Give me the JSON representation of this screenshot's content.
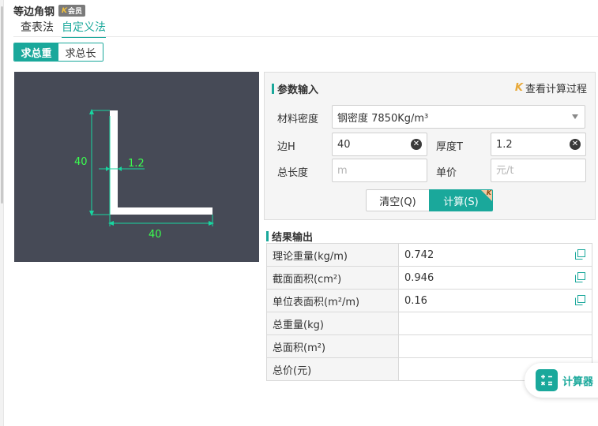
{
  "app": {
    "title": "等边角钢",
    "badge_text": "会员",
    "badge_mark": "K"
  },
  "tabs": [
    {
      "label": "查表法",
      "active": false
    },
    {
      "label": "自定义法",
      "active": true
    }
  ],
  "mode": {
    "options": [
      "求总重",
      "求总长"
    ],
    "selected": "求总重"
  },
  "diagram": {
    "height_label": "40",
    "thickness_label": "1.2",
    "width_label": "40",
    "colors": {
      "background": "#464a56",
      "shape": "#ffffff",
      "dimension": "#18d6a0",
      "label": "#3bff4f"
    }
  },
  "params": {
    "title": "参数输入",
    "view_process": "查看计算过程",
    "view_process_mark": "K",
    "material_label": "材料密度",
    "material_value": "钢密度 7850Kg/m³",
    "edge_h_label": "边H",
    "edge_h_value": "40",
    "thickness_label": "厚度T",
    "thickness_value": "1.2",
    "total_length_label": "总长度",
    "total_length_placeholder": "m",
    "unit_price_label": "单价",
    "unit_price_placeholder": "元/t",
    "clear_button": "清空(Q)",
    "calc_button": "计算(S)"
  },
  "results": {
    "title": "结果输出",
    "rows": [
      {
        "name": "理论重量(kg/m)",
        "value": "0.742",
        "copy": true
      },
      {
        "name": "截面面积(cm²)",
        "value": "0.946",
        "copy": true
      },
      {
        "name": "单位表面积(m²/m)",
        "value": "0.16",
        "copy": true
      },
      {
        "name": "总重量(kg)",
        "value": "",
        "copy": false
      },
      {
        "name": "总面积(m²)",
        "value": "",
        "copy": false
      },
      {
        "name": "总价(元)",
        "value": "",
        "copy": false
      }
    ]
  },
  "floating": {
    "calculator_label": "计算器"
  },
  "colors": {
    "accent": "#1aa89b",
    "vip_gold": "#e8a93a"
  }
}
